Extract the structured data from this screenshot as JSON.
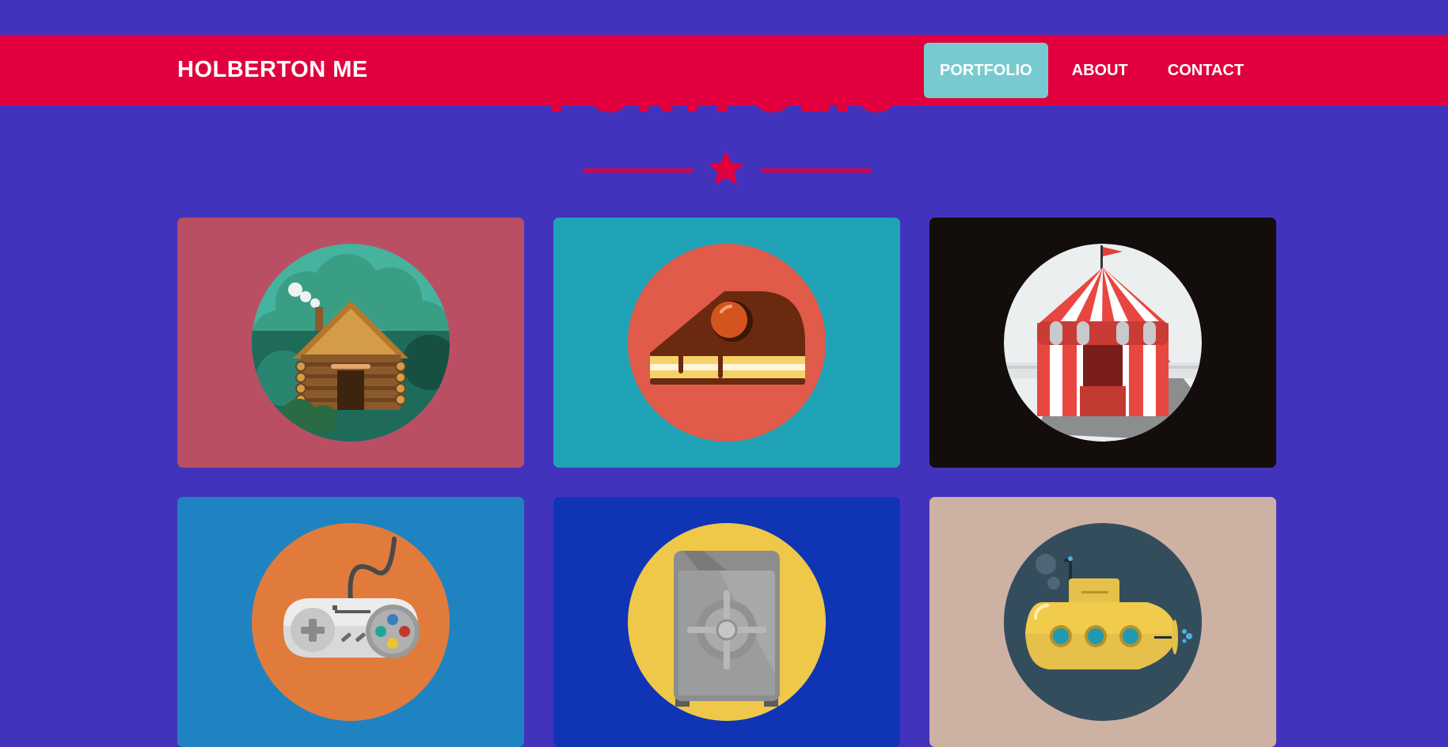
{
  "section": {
    "title": "PORTFOLIO"
  },
  "navbar": {
    "brand": "HOLBERTON ME",
    "links": [
      "PORTFOLIO",
      "ABOUT",
      "CONTACT"
    ],
    "active": "PORTFOLIO"
  },
  "colors": {
    "page_background": "#4233bd",
    "accent_red": "#e1003d",
    "active_nav": "#77cbd0"
  },
  "portfolio": [
    {
      "icon": "log-cabin-icon",
      "background": "#ba4f64",
      "circle": "#45b39d"
    },
    {
      "icon": "cake-slice-icon",
      "background": "#20a3b6",
      "circle": "#e05b49"
    },
    {
      "icon": "circus-tent-icon",
      "background": "#130d0c",
      "circle": "#eceff0"
    },
    {
      "icon": "game-controller-icon",
      "background": "#1f83c2",
      "circle": "#e17b3c"
    },
    {
      "icon": "safe-icon",
      "background": "#0f35b5",
      "circle": "#efc84a"
    },
    {
      "icon": "submarine-icon",
      "background": "#cdb1a2",
      "circle": "#344d5c"
    }
  ]
}
